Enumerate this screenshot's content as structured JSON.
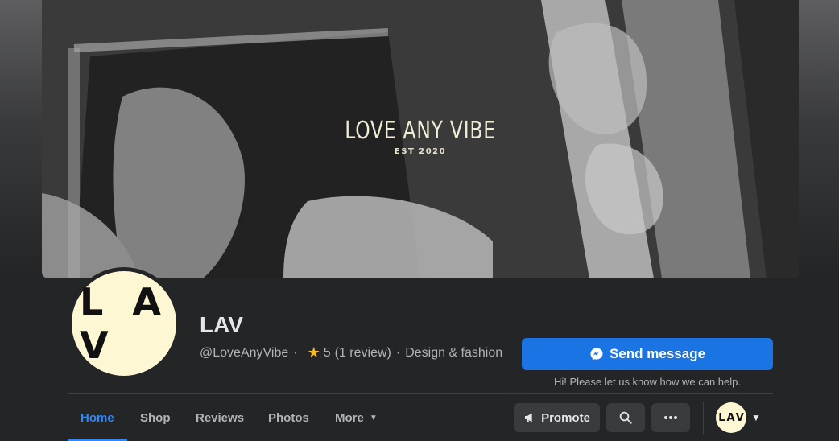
{
  "cover": {
    "title": "LOVE ANY VIBE",
    "subtitle": "EST 2020"
  },
  "profile": {
    "avatar_text": "L A V",
    "name": "LAV",
    "handle": "@LoveAnyVibe",
    "dot1": "·",
    "rating": "5",
    "reviews": "(1 review)",
    "dot2": "·",
    "category": "Design & fashion"
  },
  "cta": {
    "send_label": "Send message",
    "hint": "Hi! Please let us know how we can help."
  },
  "tabs": [
    {
      "label": "Home",
      "active": true
    },
    {
      "label": "Shop"
    },
    {
      "label": "Reviews"
    },
    {
      "label": "Photos"
    },
    {
      "label": "More"
    }
  ],
  "actions": {
    "promote_label": "Promote",
    "search_icon": "search-icon",
    "more_icon": "ellipsis-icon"
  },
  "mini_avatar_text": "LAV",
  "colors": {
    "accent": "#1b74e4",
    "active_tab": "#2d88ff",
    "background": "#242526",
    "avatar_bg": "#fdf7d3",
    "star": "#f7b928"
  }
}
